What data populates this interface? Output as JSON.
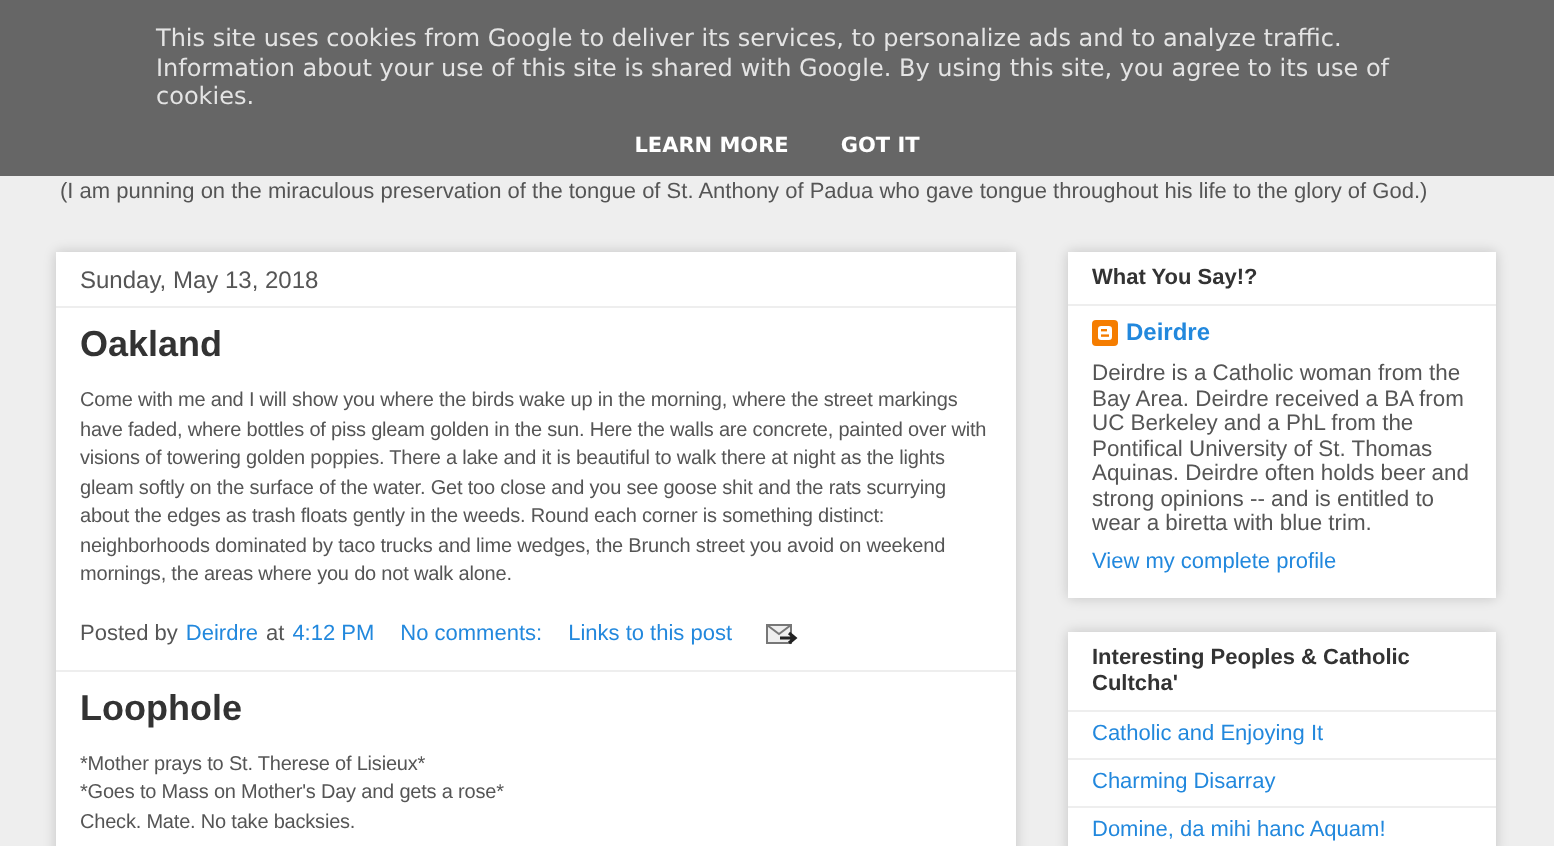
{
  "cookie_banner": {
    "message": "This site uses cookies from Google to deliver its services, to personalize ads and to analyze traffic. Information about your use of this site is shared with Google. By using this site, you agree to its use of cookies.",
    "buttons": [
      "LEARN MORE",
      "GOT IT"
    ]
  },
  "tagline": "(I am punning on the miraculous preservation of the tongue of St. Anthony of Padua who gave tongue throughout his life to the glory of God.)",
  "date_header": "Sunday, May 13, 2018",
  "posts": [
    {
      "title": "Oakland",
      "paragraphs": [
        "Come with me and I will show you where the birds wake up in the morning, where the street markings have faded, where bottles of piss gleam golden in the sun. Here the walls are concrete, painted over with visions of towering golden poppies. There a lake and it is beautiful to walk there at night as the lights gleam softly on the surface of the water. Get too close and you see goose shit and the rats scurrying about the edges as trash floats gently in the weeds. Round each corner is something distinct: neighborhoods dominated by taco trucks and lime wedges, the Brunch street you avoid on weekend mornings, the areas where you do not walk alone."
      ],
      "footer": {
        "posted_by": "Posted by",
        "author": "Deirdre",
        "at": "at",
        "time": "4:12 PM",
        "comments": "No comments:",
        "links": "Links to this post"
      }
    },
    {
      "title": "Loophole",
      "paragraphs": [
        "*Mother prays to St. Therese of Lisieux*",
        "*Goes to Mass on Mother's Day and gets a rose*",
        "Check. Mate. No take backsies."
      ]
    }
  ],
  "sidebar": [
    {
      "kind": "profile",
      "title": "What You Say!?",
      "name": "Deirdre",
      "bio": "Deirdre is a Catholic woman from the Bay Area. Deirdre received a BA from UC Berkeley and a PhL from the Pontifical University of St. Thomas Aquinas. Deirdre often holds beer and strong opinions -- and is entitled to wear a biretta with blue trim.",
      "link": "View my complete profile"
    },
    {
      "kind": "links",
      "title": "Interesting Peoples & Catholic Cultcha'",
      "items": [
        "Catholic and Enjoying It",
        "Charming Disarray",
        "Domine, da mihi hanc Aquam!"
      ]
    }
  ]
}
